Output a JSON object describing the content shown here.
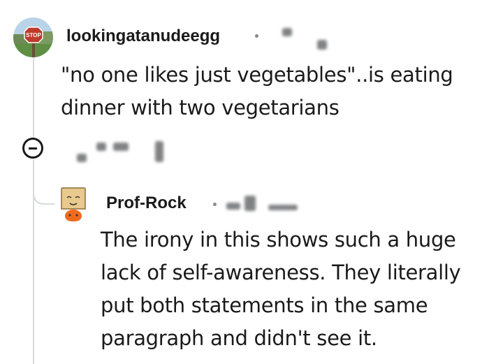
{
  "comment": {
    "username": "lookingatanudeegg",
    "body": "\"no one likes just vegetables\"..is eating dinner with two vegetarians"
  },
  "reply": {
    "username": "Prof-Rock",
    "body": "The irony in this shows such a huge lack of self-awareness. They literally put both statements in the same paragraph and didn't see it."
  },
  "icons": {
    "collapse": "minus-circle-icon"
  }
}
